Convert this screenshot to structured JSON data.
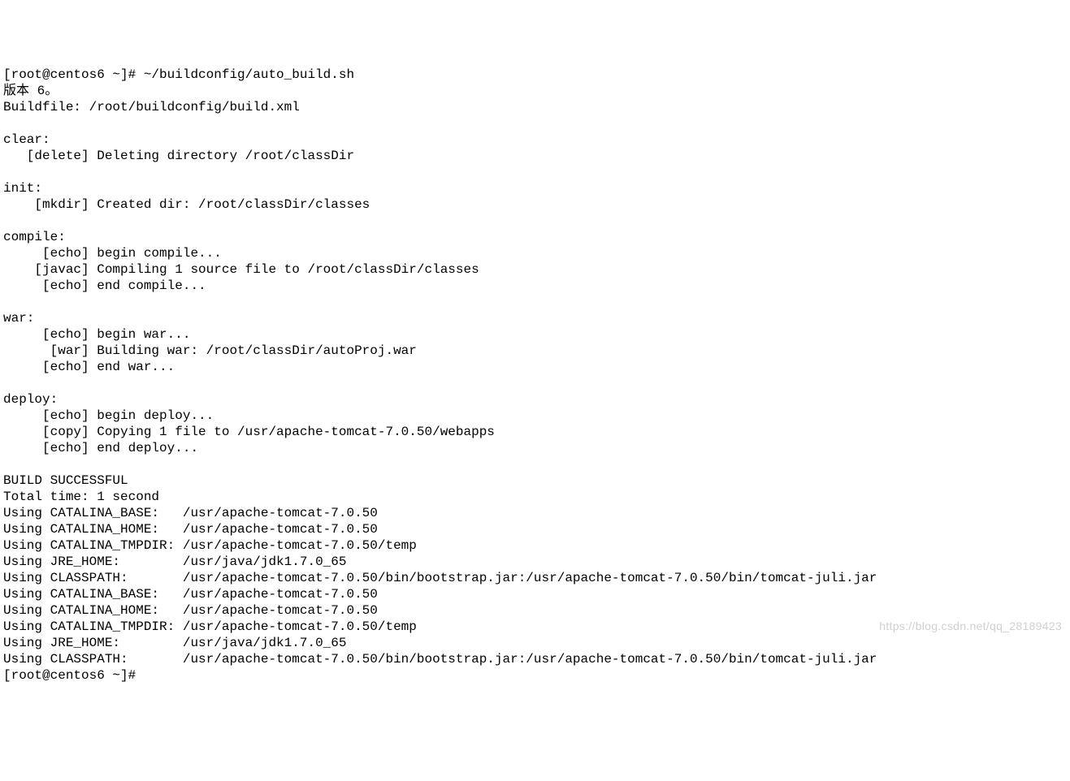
{
  "terminal": {
    "lines": [
      "[root@centos6 ~]# ~/buildconfig/auto_build.sh",
      "版本 6。",
      "Buildfile: /root/buildconfig/build.xml",
      "",
      "clear:",
      "   [delete] Deleting directory /root/classDir",
      "",
      "init:",
      "    [mkdir] Created dir: /root/classDir/classes",
      "",
      "compile:",
      "     [echo] begin compile...",
      "    [javac] Compiling 1 source file to /root/classDir/classes",
      "     [echo] end compile...",
      "",
      "war:",
      "     [echo] begin war...",
      "      [war] Building war: /root/classDir/autoProj.war",
      "     [echo] end war...",
      "",
      "deploy:",
      "     [echo] begin deploy...",
      "     [copy] Copying 1 file to /usr/apache-tomcat-7.0.50/webapps",
      "     [echo] end deploy...",
      "",
      "BUILD SUCCESSFUL",
      "Total time: 1 second",
      "Using CATALINA_BASE:   /usr/apache-tomcat-7.0.50",
      "Using CATALINA_HOME:   /usr/apache-tomcat-7.0.50",
      "Using CATALINA_TMPDIR: /usr/apache-tomcat-7.0.50/temp",
      "Using JRE_HOME:        /usr/java/jdk1.7.0_65",
      "Using CLASSPATH:       /usr/apache-tomcat-7.0.50/bin/bootstrap.jar:/usr/apache-tomcat-7.0.50/bin/tomcat-juli.jar",
      "Using CATALINA_BASE:   /usr/apache-tomcat-7.0.50",
      "Using CATALINA_HOME:   /usr/apache-tomcat-7.0.50",
      "Using CATALINA_TMPDIR: /usr/apache-tomcat-7.0.50/temp",
      "Using JRE_HOME:        /usr/java/jdk1.7.0_65",
      "Using CLASSPATH:       /usr/apache-tomcat-7.0.50/bin/bootstrap.jar:/usr/apache-tomcat-7.0.50/bin/tomcat-juli.jar",
      "[root@centos6 ~]#"
    ]
  },
  "watermark": "https://blog.csdn.net/qq_28189423"
}
